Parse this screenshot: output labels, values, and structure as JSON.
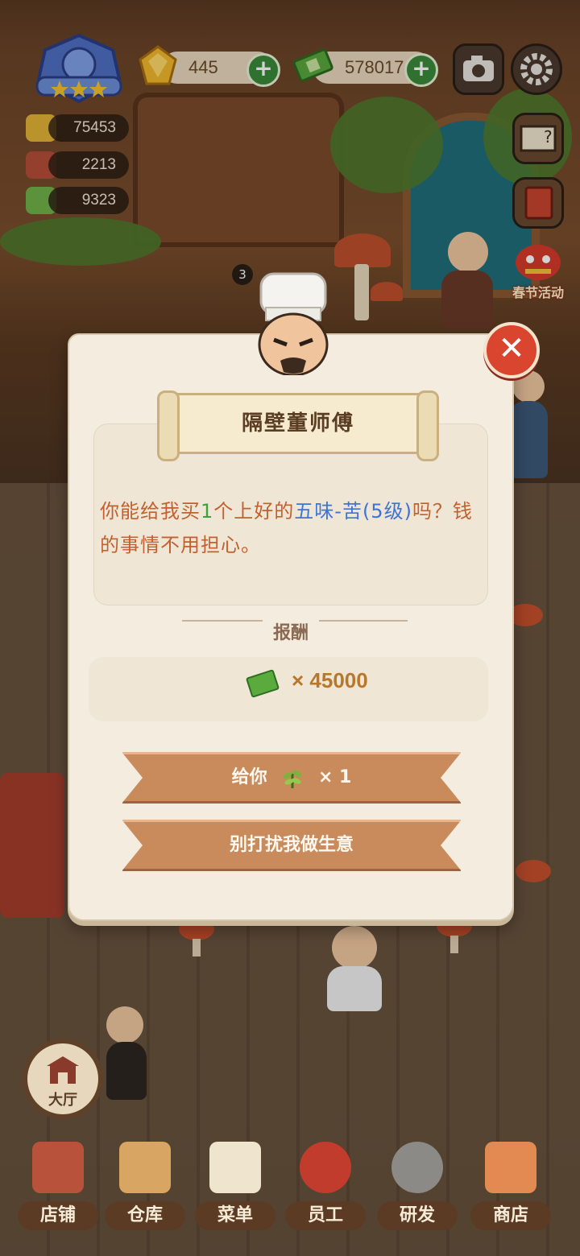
{
  "hud": {
    "gems": "445",
    "cash": "578017",
    "stats": [
      "75453",
      "2213",
      "9323"
    ],
    "level_badge_stars": 3,
    "side_button_count": "3",
    "event_label": "春节活动"
  },
  "dialog": {
    "npc_name": "隔壁董师傅",
    "request_prefix": "你能给我买",
    "request_qty": "1",
    "request_mid": "个上好的",
    "request_item": "五味-苦(5级)",
    "request_suffix": "吗？钱的事情不用担心。",
    "reward_label": "报酬",
    "reward_amount": "× 45000",
    "give_label": "给你",
    "give_qty": "× 1",
    "refuse_label": "别打扰我做生意"
  },
  "lobby": {
    "label": "大厅"
  },
  "nav": [
    {
      "label": "店铺"
    },
    {
      "label": "仓库"
    },
    {
      "label": "菜单"
    },
    {
      "label": "员工"
    },
    {
      "label": "研发"
    },
    {
      "label": "商店"
    }
  ],
  "colors": {
    "accent_green": "#3aa33a",
    "accent_blue": "#3d74d6",
    "button_brown": "#c98b5c",
    "close_red": "#d9452e"
  }
}
